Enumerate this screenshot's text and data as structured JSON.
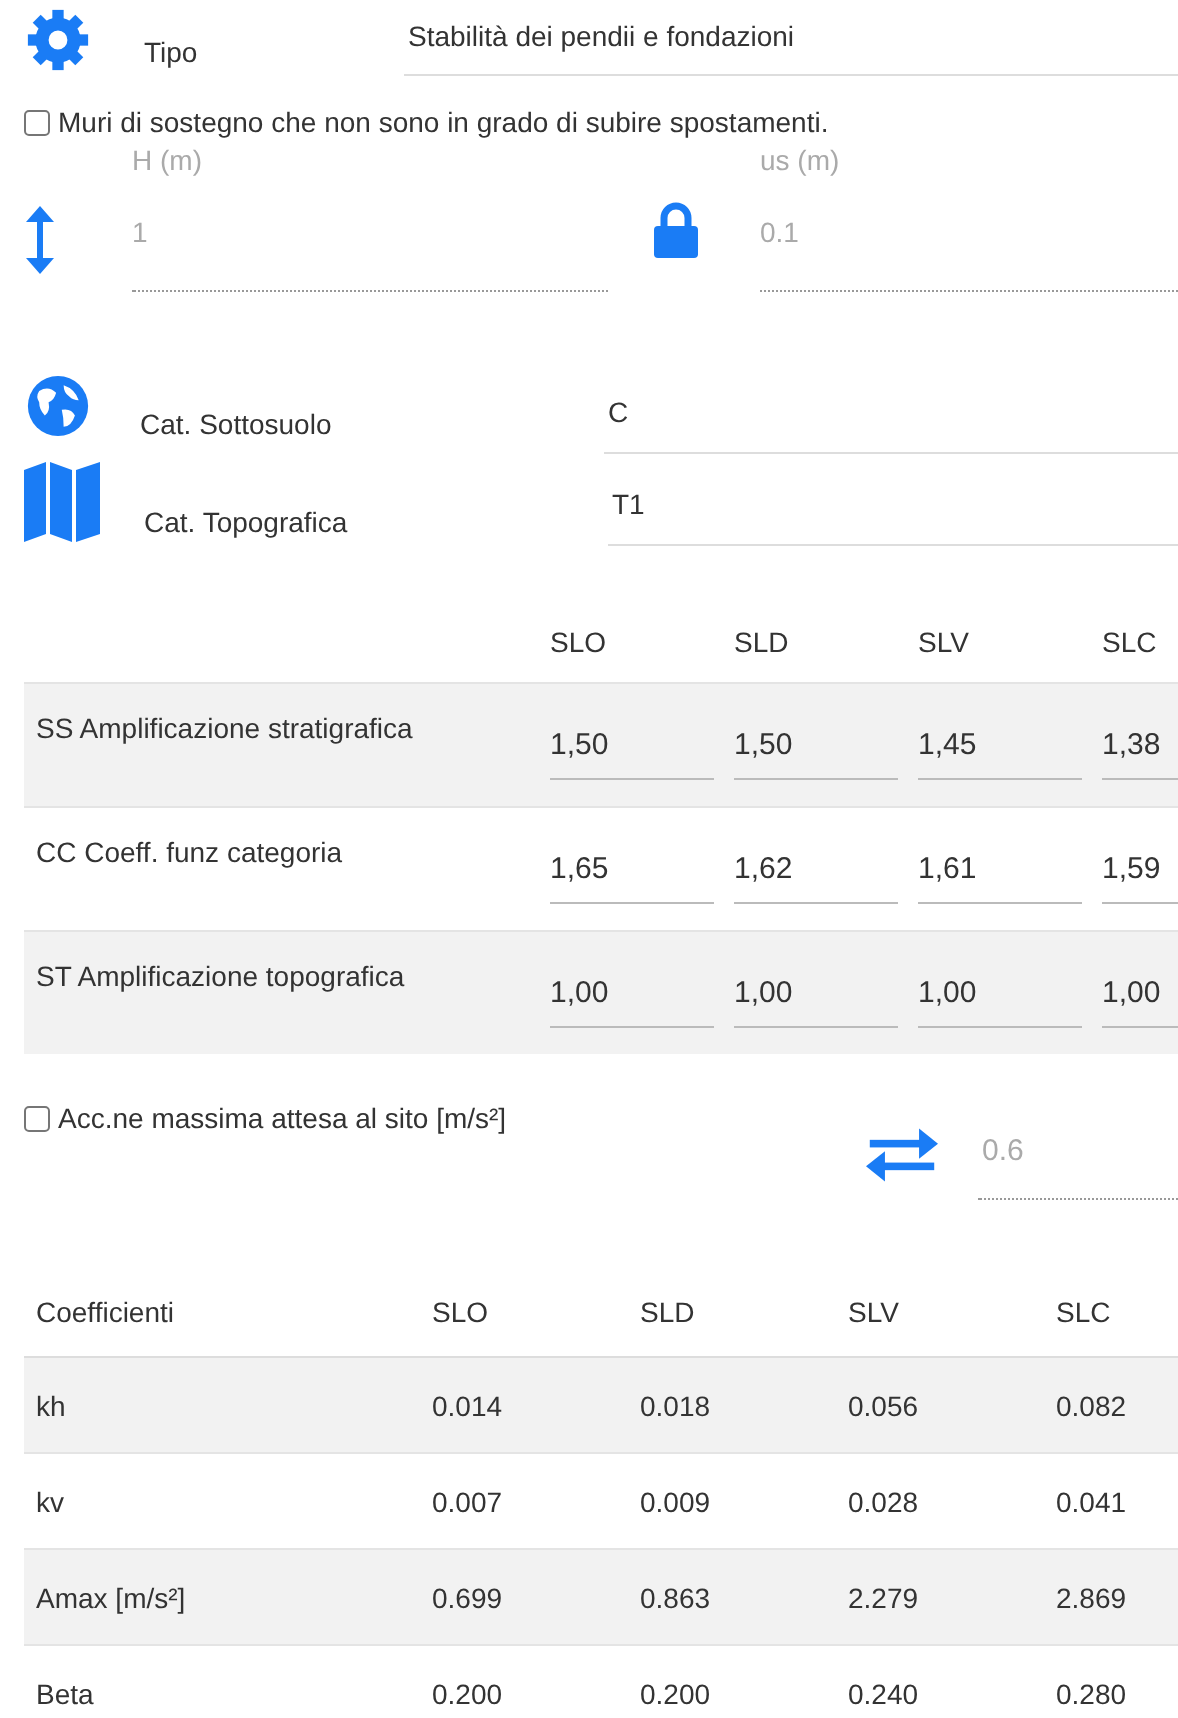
{
  "tipo": {
    "label": "Tipo",
    "value": "Stabilità dei pendii e fondazioni"
  },
  "wall_option": {
    "label": "Muri di sostegno che non sono in grado di subire spostamenti.",
    "checked": false
  },
  "wall_fields": [
    {
      "label": "H (m)",
      "value": "1",
      "disabled": true
    },
    {
      "label": "us (m)",
      "value": "0.1",
      "disabled": true
    }
  ],
  "categories": [
    {
      "label": "Cat. Sottosuolo",
      "value": "C"
    },
    {
      "label": "Cat. Topografica",
      "value": "T1"
    }
  ],
  "amplification": {
    "columns": [
      "SLO",
      "SLD",
      "SLV",
      "SLC"
    ],
    "rows": [
      {
        "label": "SS Amplificazione stratigrafica",
        "values": [
          "1,50",
          "1,50",
          "1,45",
          "1,38"
        ]
      },
      {
        "label": "CC Coeff. funz categoria",
        "values": [
          "1,65",
          "1,62",
          "1,61",
          "1,59"
        ]
      },
      {
        "label": "ST Amplificazione topografica",
        "values": [
          "1,00",
          "1,00",
          "1,00",
          "1,00"
        ]
      }
    ]
  },
  "acceleration": {
    "label": "Acc.ne massima attesa al sito [m/s²]",
    "checked": false,
    "value": "0.6",
    "disabled": true
  },
  "coefficients": {
    "columns": [
      "Coefficienti",
      "SLO",
      "SLD",
      "SLV",
      "SLC"
    ],
    "rows": [
      {
        "label": "kh",
        "values": [
          "0.014",
          "0.018",
          "0.056",
          "0.082"
        ]
      },
      {
        "label": "kv",
        "values": [
          "0.007",
          "0.009",
          "0.028",
          "0.041"
        ]
      },
      {
        "label": "Amax [m/s²]",
        "values": [
          "0.699",
          "0.863",
          "2.279",
          "2.869"
        ]
      },
      {
        "label": "Beta",
        "values": [
          "0.200",
          "0.200",
          "0.240",
          "0.280"
        ]
      }
    ]
  }
}
